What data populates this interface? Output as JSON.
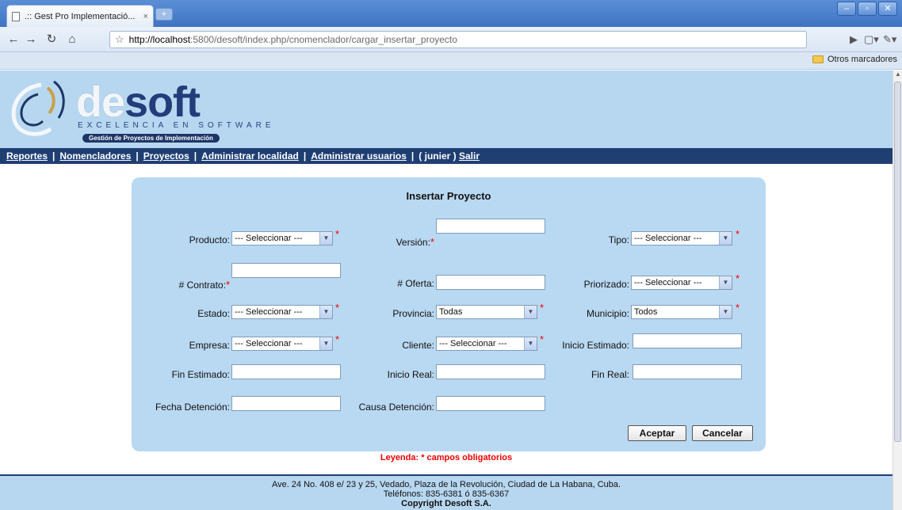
{
  "browser": {
    "tab_title": ".:: Gest Pro Implementació...",
    "tab_close": "×",
    "new_tab": "+",
    "url_host": "http://localhost",
    "url_rest": ":5800/desoft/index.php/cnomenclador/cargar_insertar_proyecto",
    "bookmark_folder": "Otros marcadores"
  },
  "header": {
    "logo_part1": "de",
    "logo_part2": "soft",
    "tagline": "EXCELENCIA EN SOFTWARE",
    "subtitle": "Gestión de Proyectos de Implementación"
  },
  "menu": {
    "items": [
      "Reportes",
      "Nomencladores",
      "Proyectos",
      "Administrar localidad",
      "Administrar usuarios"
    ],
    "user": "( junier )",
    "logout": "Salir"
  },
  "form": {
    "title": "Insertar Proyecto",
    "required_mark": "*",
    "fields": {
      "producto": {
        "label": "Producto:",
        "value": "--- Seleccionar ---"
      },
      "version": {
        "label": "Versión:",
        "value": ""
      },
      "tipo": {
        "label": "Tipo:",
        "value": "--- Seleccionar ---"
      },
      "contrato": {
        "label": "# Contrato:",
        "value": ""
      },
      "oferta": {
        "label": "# Oferta:",
        "value": ""
      },
      "priorizado": {
        "label": "Priorizado:",
        "value": "--- Seleccionar ---"
      },
      "estado": {
        "label": "Estado:",
        "value": "--- Seleccionar ---"
      },
      "provincia": {
        "label": "Provincia:",
        "value": "Todas"
      },
      "municipio": {
        "label": "Municipio:",
        "value": "Todos"
      },
      "empresa": {
        "label": "Empresa:",
        "value": "--- Seleccionar ---"
      },
      "cliente": {
        "label": "Cliente:",
        "value": "--- Seleccionar ---"
      },
      "inicio_estimado": {
        "label": "Inicio Estimado:",
        "value": ""
      },
      "fin_estimado": {
        "label": "Fin Estimado:",
        "value": ""
      },
      "inicio_real": {
        "label": "Inicio Real:",
        "value": ""
      },
      "fin_real": {
        "label": "Fin Real:",
        "value": ""
      },
      "fecha_detencion": {
        "label": "Fecha Detención:",
        "value": ""
      },
      "causa_detencion": {
        "label": "Causa Detención:",
        "value": ""
      }
    },
    "accept_label": "Aceptar",
    "cancel_label": "Cancelar",
    "legend": "Leyenda: * campos obligatorios"
  },
  "footer": {
    "address": "Ave. 24 No. 408 e/ 23 y 25, Vedado, Plaza de la Revolución, Ciudad de La Habana, Cuba.",
    "phones": "Teléfonos: 835-6381 ó 835-6367",
    "copyright": "Copyright Desoft S.A."
  }
}
